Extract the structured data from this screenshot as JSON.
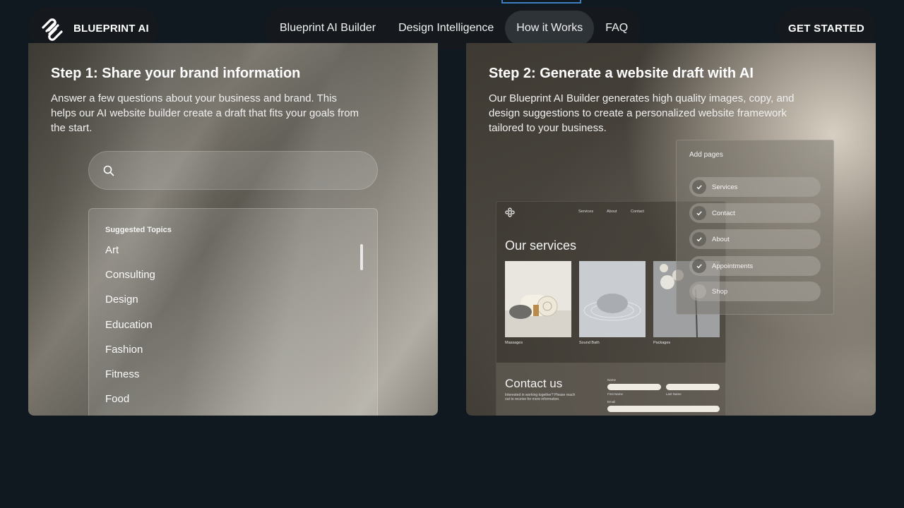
{
  "nav": {
    "brand_name": "BLUEPRINT AI",
    "menu": [
      {
        "label": "Blueprint AI Builder",
        "active": false
      },
      {
        "label": "Design Intelligence",
        "active": false
      },
      {
        "label": "How it Works",
        "active": true
      },
      {
        "label": "FAQ",
        "active": false
      }
    ],
    "cta": "GET STARTED"
  },
  "step1": {
    "title": "Step 1: Share your brand information",
    "description": "Answer a few questions about your business and brand. This helps our AI website builder create a draft that fits your goals from the start.",
    "search_value": "",
    "topics_label": "Suggested Topics",
    "topics": [
      "Art",
      "Consulting",
      "Design",
      "Education",
      "Fashion",
      "Fitness",
      "Food"
    ]
  },
  "step2": {
    "title": "Step 2: Generate a website draft with AI",
    "description": "Our Blueprint AI Builder generates high quality images, copy, and design suggestions to create a personalized website framework tailored to your business.",
    "mockup": {
      "nav": [
        "Services",
        "About",
        "Contact"
      ],
      "heading": "Our services",
      "tiles": [
        "Massages",
        "Sound Bath",
        "Packages"
      ],
      "contact_title": "Contact us",
      "contact_text": "Interested in working together? Please reach out to receive for more information.",
      "name_label": "Name",
      "first_name_label": "First Name",
      "last_name_label": "Last Name",
      "email_label": "Email"
    },
    "pages_panel": {
      "label": "Add pages",
      "pages": [
        {
          "name": "Services",
          "checked": true
        },
        {
          "name": "Contact",
          "checked": true
        },
        {
          "name": "About",
          "checked": true
        },
        {
          "name": "Appointments",
          "checked": true
        },
        {
          "name": "Shop",
          "checked": false
        }
      ]
    }
  },
  "colors": {
    "background": "#101820",
    "nav_pill": "#15191d",
    "active_menu": "#2e3338"
  }
}
